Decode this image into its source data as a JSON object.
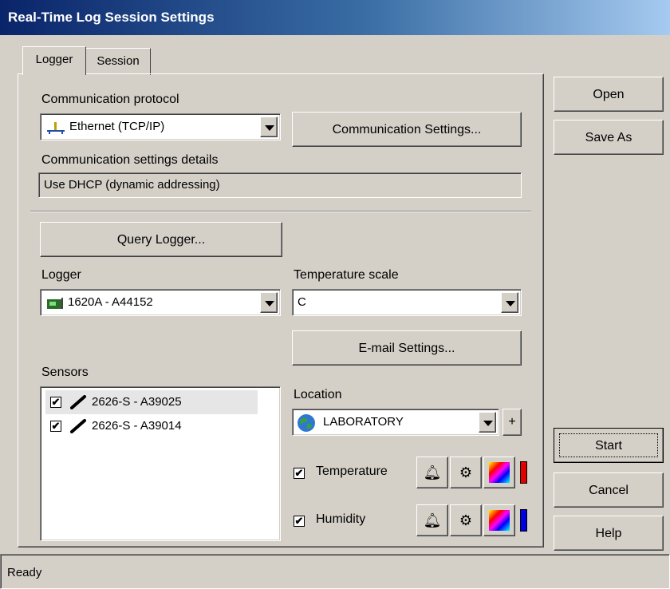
{
  "window": {
    "title": "Real-Time Log Session Settings"
  },
  "tabs": [
    {
      "label": "Logger"
    },
    {
      "label": "Session"
    }
  ],
  "protocol": {
    "label": "Communication protocol",
    "value": "Ethernet (TCP/IP)",
    "settings_button": "Communication Settings...",
    "details_label": "Communication settings details",
    "details_value": "Use DHCP (dynamic addressing)"
  },
  "query_button": "Query Logger...",
  "logger": {
    "label": "Logger",
    "value": "1620A - A44152"
  },
  "temperature_scale": {
    "label": "Temperature scale",
    "value": "C"
  },
  "email_button": "E-mail Settings...",
  "sensors": {
    "label": "Sensors",
    "items": [
      {
        "label": "2626-S - A39025",
        "checked": true,
        "selected": true
      },
      {
        "label": "2626-S - A39014",
        "checked": true,
        "selected": false
      }
    ]
  },
  "location": {
    "label": "Location",
    "value": "LABORATORY",
    "add_label": "+"
  },
  "measurements": [
    {
      "label": "Temperature",
      "checked": true,
      "color": "#e00000"
    },
    {
      "label": "Humidity",
      "checked": true,
      "color": "#0000e0"
    }
  ],
  "side_buttons": {
    "open": "Open",
    "save_as": "Save As",
    "start": "Start",
    "cancel": "Cancel",
    "help": "Help"
  },
  "status": {
    "text": "Ready"
  },
  "colors": {
    "title_start": "#0a246a",
    "title_end": "#a6caf0"
  }
}
